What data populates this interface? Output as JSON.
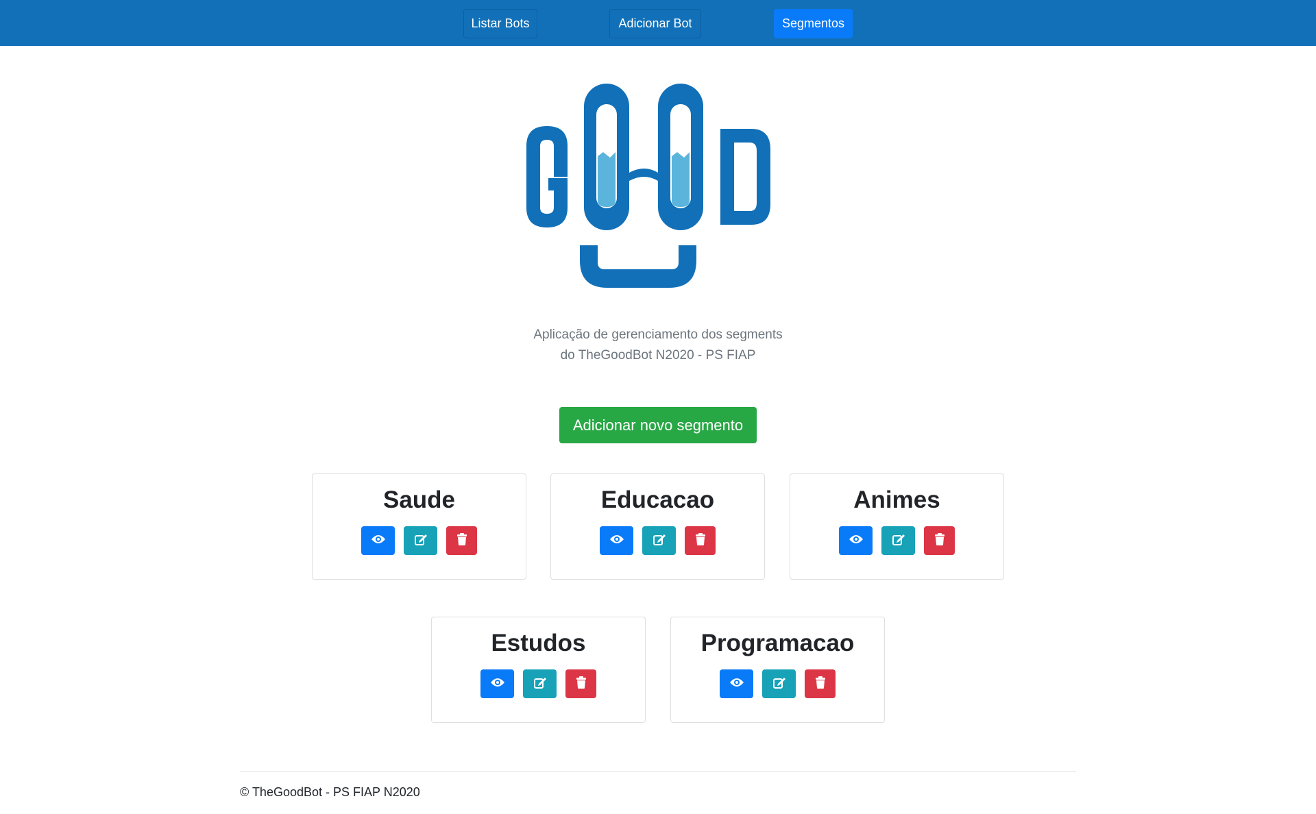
{
  "nav": {
    "items": [
      {
        "label": "Listar Bots"
      },
      {
        "label": "Adicionar Bot"
      },
      {
        "label": "Segmentos"
      }
    ]
  },
  "logo": {
    "text": "GOOD"
  },
  "subtitle": {
    "line1": "Aplicação de gerenciamento dos segments",
    "line2": "do TheGoodBot N2020 - PS FIAP"
  },
  "add_button_label": "Adicionar novo segmento",
  "segments": [
    {
      "name": "Saude"
    },
    {
      "name": "Educacao"
    },
    {
      "name": "Animes"
    },
    {
      "name": "Estudos"
    },
    {
      "name": "Programacao"
    }
  ],
  "footer": {
    "text": "© TheGoodBot - PS FIAP N2020"
  },
  "colors": {
    "navbar": "#1170b8",
    "primary": "#0a7bf8",
    "success": "#28a745",
    "info": "#17a2b8",
    "danger": "#dc3545"
  },
  "icons": {
    "view": "eye-icon",
    "edit": "edit-icon",
    "delete": "trash-icon"
  }
}
